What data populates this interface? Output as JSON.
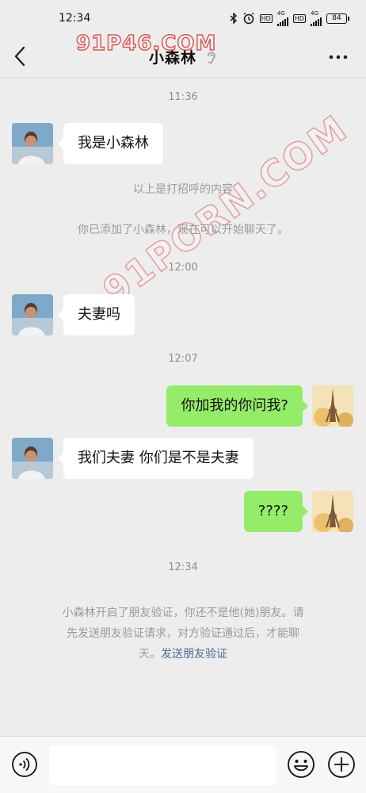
{
  "status_bar": {
    "time": "12:34",
    "network_1": "4G",
    "network_2": "4G",
    "hd_1": "HD",
    "hd_2": "HD",
    "battery": "84"
  },
  "header": {
    "title": "小森林",
    "watermark_small": "91P46.COM",
    "back_icon": "chevron-left-icon",
    "ear_icon": "ear-icon",
    "more_icon": "more-dots-icon"
  },
  "watermark": {
    "text": "91PORN.COM"
  },
  "messages": [
    {
      "time": "11:36"
    },
    {
      "from": "other",
      "text": "我是小森林"
    },
    {
      "system": "以上是打招呼的内容"
    },
    {
      "system": "你已添加了小森林，现在可以开始聊天了。"
    },
    {
      "time": "12:00"
    },
    {
      "from": "other",
      "text": "夫妻吗"
    },
    {
      "time": "12:07"
    },
    {
      "from": "me",
      "text": "你加我的你问我?"
    },
    {
      "from": "other",
      "text": "我们夫妻 你们是不是夫妻"
    },
    {
      "from": "me",
      "text": "????"
    },
    {
      "time": "12:34"
    },
    {
      "system_line1": "小森林开启了朋友验证，你还不是他(她)朋友。请",
      "system_line2": "先发送朋友验证请求，对方验证通过后，才能聊",
      "system_line3": "天。",
      "link": "发送朋友验证"
    }
  ],
  "input_bar": {
    "voice_icon": "voice-icon",
    "emoji_icon": "emoji-icon",
    "plus_icon": "plus-circle-icon",
    "input_value": ""
  },
  "colors": {
    "background": "#ededed",
    "bubble_out": "#95ec69",
    "bubble_in": "#ffffff",
    "link": "#4f6b95",
    "watermark": "#d63c3c"
  }
}
